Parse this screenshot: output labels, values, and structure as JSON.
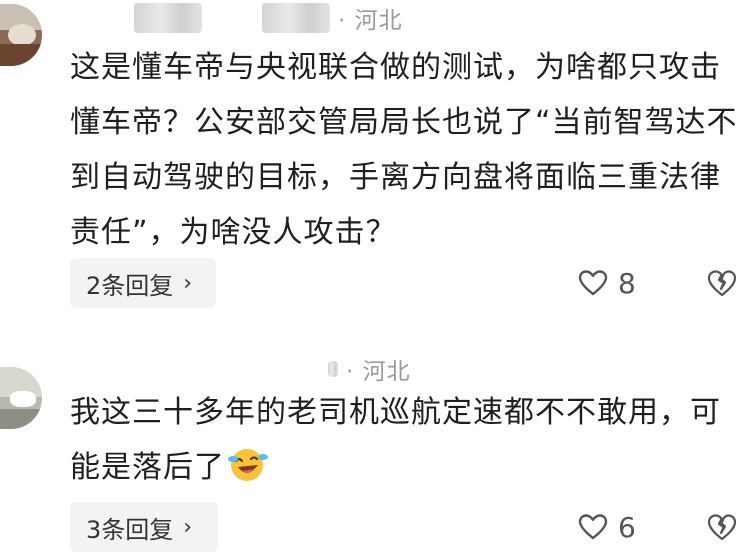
{
  "comments": [
    {
      "location": "· 河北",
      "text": "这是懂车帝与央视联合做的测试，为啥都只攻击懂车帝？公安部交管局局长也说了“当前智驾达不到自动驾驶的目标，手离方向盘将面临三重法律责任”，为啥没人攻击？",
      "replies_label": "2条回复",
      "like_count": "8"
    },
    {
      "location": "· 河北",
      "text": "我这三十多年的老司机巡航定速都不不敢用，可能是落后了",
      "emoji": "laughing-crying-emoji",
      "replies_label": "3条回复",
      "like_count": "6"
    }
  ],
  "icons": {
    "chevron": "chevron-right-icon",
    "like": "heart-icon",
    "dislike": "broken-heart-icon"
  },
  "colors": {
    "text": "#1f1f1f",
    "location": "#9a9a9a",
    "reply_bg": "#f3f3f3",
    "icon": "#555555",
    "emoji_yellow": "#f6c33b"
  }
}
